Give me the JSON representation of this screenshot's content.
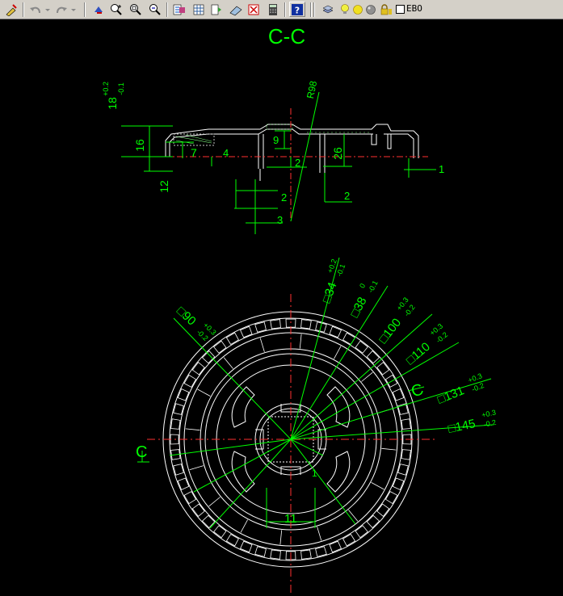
{
  "toolbar": {
    "buttons": [
      {
        "icon": "match-properties-icon"
      },
      {
        "icon": "undo-icon"
      },
      {
        "icon": "redo-icon"
      },
      {
        "icon": "pan-icon"
      },
      {
        "icon": "zoom-realtime-icon"
      },
      {
        "icon": "zoom-window-icon"
      },
      {
        "icon": "zoom-previous-icon"
      },
      {
        "icon": "properties-icon"
      },
      {
        "icon": "design-center-icon"
      },
      {
        "icon": "tool-palettes-icon"
      },
      {
        "icon": "sheet-set-icon"
      },
      {
        "icon": "markup-icon"
      },
      {
        "icon": "calculator-icon"
      },
      {
        "icon": "help-icon"
      },
      {
        "icon": "layer-properties-icon"
      }
    ],
    "layer": {
      "name": "EBO",
      "icons": [
        "lightbulb-icon",
        "sun-icon",
        "sphere-icon",
        "lock-icon"
      ]
    }
  },
  "drawing": {
    "section_title": "C-C",
    "section_marker": "C",
    "radius_label": "R98",
    "dims": {
      "d18_base": "18",
      "d18_tol_up": "+0.2",
      "d18_tol_dn": "-0.1",
      "d16": "16",
      "d12": "12",
      "d7": "7",
      "d4": "4",
      "d9": "9",
      "d2a": "2",
      "d2b": "2",
      "d2c": "2",
      "d26": "26",
      "d1": "1",
      "d3": "3",
      "d11": "11",
      "d1_center": "1"
    },
    "squares": [
      {
        "base": "□34",
        "up": "+0.2",
        "dn": "-0.1"
      },
      {
        "base": "□38",
        "up": "0",
        "dn": "-0.1"
      },
      {
        "base": "□100",
        "up": "+0.3",
        "dn": "-0.2"
      },
      {
        "base": "□110",
        "up": "+0.3",
        "dn": "-0.2"
      },
      {
        "base": "□131",
        "up": "+0.3",
        "dn": "-0.2"
      },
      {
        "base": "□145",
        "up": "+0.3",
        "dn": "-0.2"
      },
      {
        "base": "□90",
        "up": "+0.3",
        "dn": "-0.2"
      }
    ]
  }
}
